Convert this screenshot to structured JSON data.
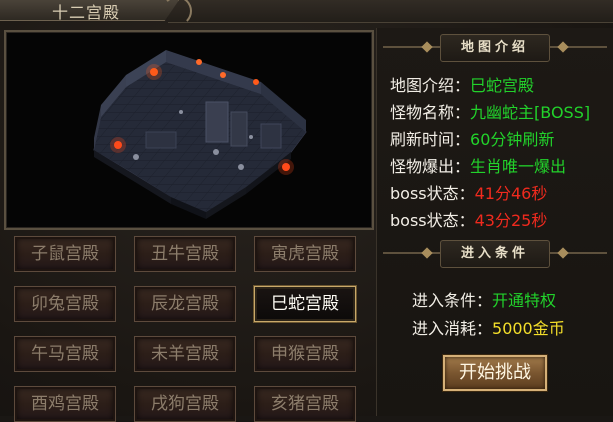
{
  "window": {
    "title": "十二宫殿"
  },
  "palaces": [
    {
      "label": "子鼠宫殿",
      "active": false
    },
    {
      "label": "丑牛宫殿",
      "active": false
    },
    {
      "label": "寅虎宫殿",
      "active": false
    },
    {
      "label": "卯兔宫殿",
      "active": false
    },
    {
      "label": "辰龙宫殿",
      "active": false
    },
    {
      "label": "巳蛇宫殿",
      "active": true
    },
    {
      "label": "午马宫殿",
      "active": false
    },
    {
      "label": "未羊宫殿",
      "active": false
    },
    {
      "label": "申猴宫殿",
      "active": false
    },
    {
      "label": "酉鸡宫殿",
      "active": false
    },
    {
      "label": "戌狗宫殿",
      "active": false
    },
    {
      "label": "亥猪宫殿",
      "active": false
    }
  ],
  "map_intro": {
    "header": "地图介绍",
    "rows": [
      {
        "key": "地图介绍：",
        "value": "巳蛇宫殿",
        "color": "green"
      },
      {
        "key": "怪物名称：",
        "value": "九幽蛇主[BOSS]",
        "color": "green"
      },
      {
        "key": "刷新时间：",
        "value": "60分钟刷新",
        "color": "green"
      },
      {
        "key": "怪物爆出：",
        "value": "生肖唯一爆出",
        "color": "green"
      },
      {
        "key": "boss状态：",
        "value": "41分46秒",
        "color": "red"
      },
      {
        "key": "boss状态：",
        "value": "43分25秒",
        "color": "red"
      }
    ]
  },
  "entry": {
    "header": "进入条件",
    "condition_key": "进入条件：",
    "condition_value": "开通特权",
    "cost_key": "进入消耗：",
    "cost_value": "5000金币",
    "start_label": "开始挑战"
  },
  "colors": {
    "green": "#22d22b",
    "red": "#f02a1e",
    "yellow": "#f4df2a",
    "gold_border": "#c9a96a"
  }
}
